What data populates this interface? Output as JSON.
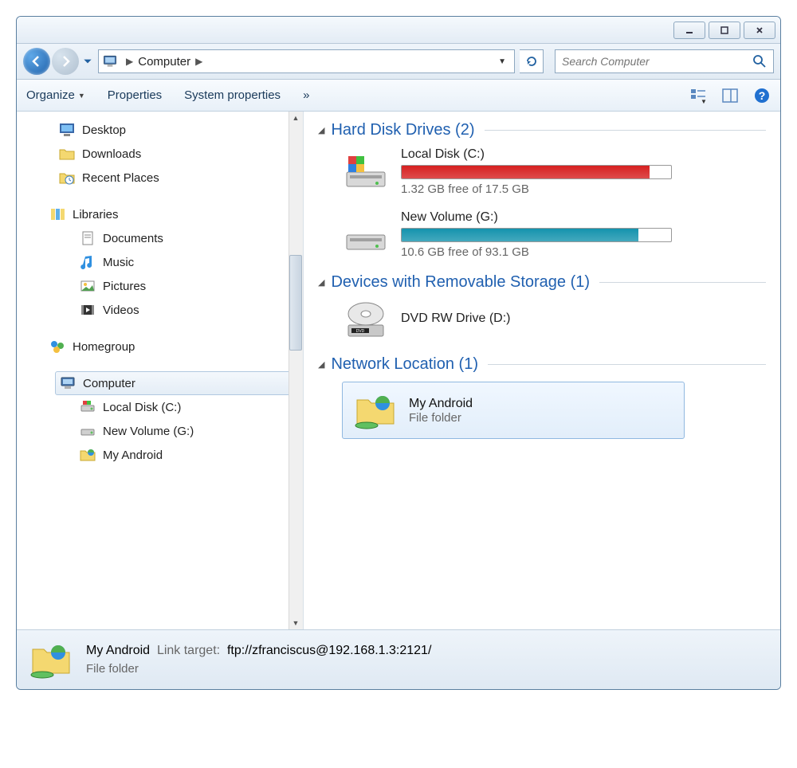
{
  "window_controls": {
    "min": "minimize",
    "max": "maximize",
    "close": "close"
  },
  "address": {
    "location": "Computer"
  },
  "search": {
    "placeholder": "Search Computer"
  },
  "toolbar": {
    "organize": "Organize",
    "properties": "Properties",
    "system_properties": "System properties",
    "more": "»"
  },
  "sidebar": {
    "desktop": "Desktop",
    "downloads": "Downloads",
    "recent": "Recent Places",
    "libraries": "Libraries",
    "documents": "Documents",
    "music": "Music",
    "pictures": "Pictures",
    "videos": "Videos",
    "homegroup": "Homegroup",
    "computer": "Computer",
    "local_disk": "Local Disk (C:)",
    "new_volume": "New Volume (G:)",
    "my_android": "My Android"
  },
  "content": {
    "hdd_header": "Hard Disk Drives (2)",
    "drives": [
      {
        "name": "Local Disk (C:)",
        "status": "1.32 GB free of 17.5 GB",
        "fill_pct": 92,
        "color": "#d62020"
      },
      {
        "name": "New Volume (G:)",
        "status": "10.6 GB free of 93.1 GB",
        "fill_pct": 88,
        "color": "#1593ad"
      }
    ],
    "removable_header": "Devices with Removable Storage (1)",
    "dvd": "DVD RW Drive (D:)",
    "network_header": "Network Location (1)",
    "network_item": {
      "name": "My Android",
      "type": "File folder"
    }
  },
  "status": {
    "name": "My Android",
    "link_label": "Link target:",
    "link_target": "ftp://zfranciscus@192.168.1.3:2121/",
    "type": "File folder"
  }
}
